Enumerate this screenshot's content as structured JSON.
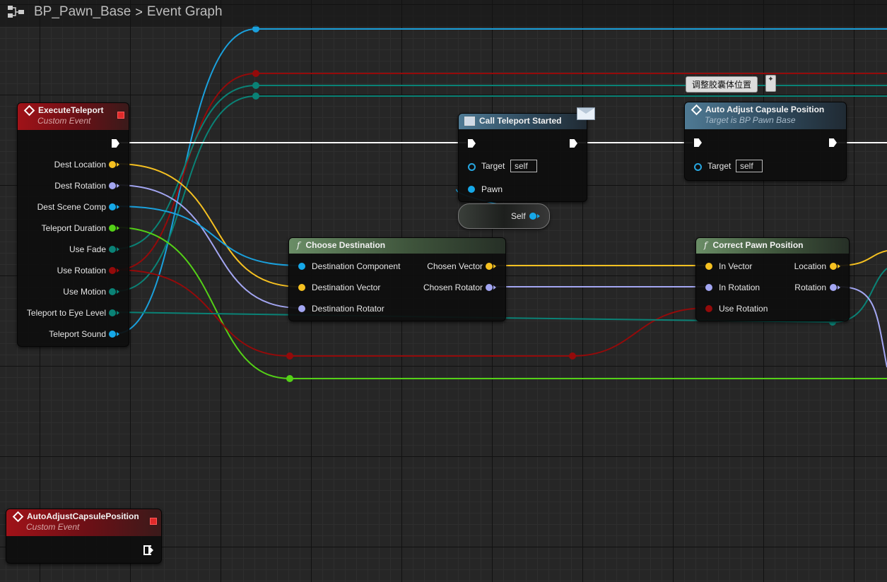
{
  "breadcrumb": {
    "blueprint": "BP_Pawn_Base",
    "graph": "Event Graph"
  },
  "icons": {
    "blueprint": "blueprint-graph-icon",
    "separator": "chevron-right-icon"
  },
  "colors": {
    "exec": "#ffffff",
    "vector": "#f6c121",
    "rotator": "#a3a6f2",
    "object": "#16a8e8",
    "bool": "#940a0a",
    "float": "#54d117",
    "teal": "#0a8276",
    "event_header": "#a01218",
    "message_header": "#4f7a94",
    "function_header": "#6a8d66"
  },
  "nodes": {
    "execute_teleport": {
      "title": "ExecuteTeleport",
      "subtitle": "Custom Event",
      "outputs": [
        "Dest Location",
        "Dest Rotation",
        "Dest Scene Comp",
        "Teleport Duration",
        "Use Fade",
        "Use Rotation",
        "Use Motion",
        "Teleport to Eye Level",
        "Teleport Sound"
      ]
    },
    "call_teleport_started": {
      "title": "Call Teleport Started",
      "target_label": "Target",
      "target_value": "self",
      "pawn_label": "Pawn"
    },
    "self_ref": {
      "label": "Self"
    },
    "comment": {
      "text": "调整胶囊体位置"
    },
    "auto_adjust": {
      "title": "Auto Adjust Capsule Position",
      "subtitle": "Target is BP Pawn Base",
      "target_label": "Target",
      "target_value": "self"
    },
    "choose_destination": {
      "title": "Choose Destination",
      "inputs": [
        "Destination Component",
        "Destination Vector",
        "Destination Rotator"
      ],
      "outputs": [
        "Chosen Vector",
        "Chosen Rotator"
      ]
    },
    "correct_pawn_position": {
      "title": "Correct Pawn Position",
      "inputs": [
        "In Vector",
        "In Rotation",
        "Use Rotation"
      ],
      "outputs": [
        "Location",
        "Rotation"
      ]
    },
    "auto_adjust_event": {
      "title": "AutoAdjustCapsulePosition",
      "subtitle": "Custom Event"
    }
  }
}
